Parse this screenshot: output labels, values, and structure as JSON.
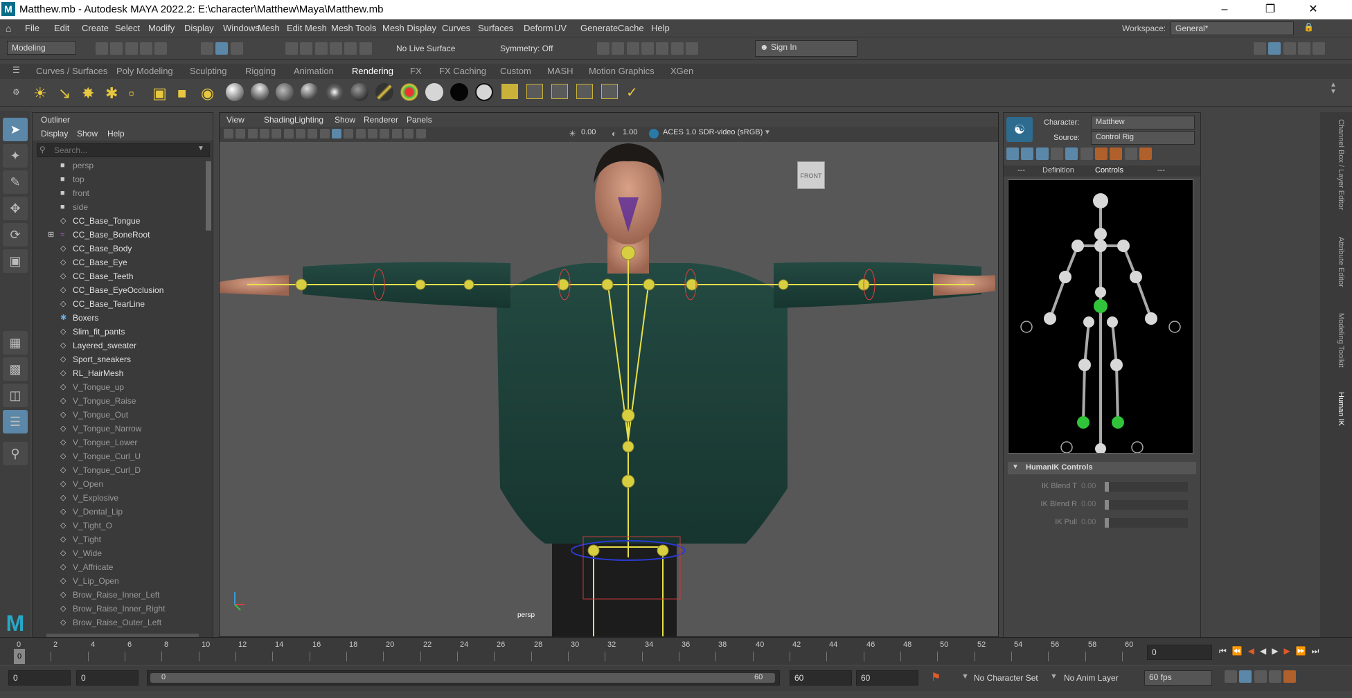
{
  "window": {
    "title": "Matthew.mb - Autodesk MAYA 2022.2: E:\\character\\Matthew\\Maya\\Matthew.mb",
    "logo": "M"
  },
  "menu": [
    "File",
    "Edit",
    "Create",
    "Select",
    "Modify",
    "Display",
    "Windows",
    "Mesh",
    "Edit Mesh",
    "Mesh Tools",
    "Mesh Display",
    "Curves",
    "Surfaces",
    "Deform",
    "UV",
    "Generate",
    "Cache",
    "Help"
  ],
  "workspace": {
    "label": "Workspace:",
    "value": "General*"
  },
  "status": {
    "mode": "Modeling",
    "live_surface": "No Live Surface",
    "symmetry": "Symmetry: Off",
    "sign_in": "Sign In"
  },
  "shelf_tabs": [
    "Curves / Surfaces",
    "Poly Modeling",
    "Sculpting",
    "Rigging",
    "Animation",
    "Rendering",
    "FX",
    "FX Caching",
    "Custom",
    "MASH",
    "Motion Graphics",
    "XGen"
  ],
  "shelf_active": "Rendering",
  "outliner": {
    "title": "Outliner",
    "menu": [
      "Display",
      "Show",
      "Help"
    ],
    "search_placeholder": "Search...",
    "items": [
      {
        "label": "persp",
        "icon": "camera-icon",
        "dim": true
      },
      {
        "label": "top",
        "icon": "camera-icon",
        "dim": true
      },
      {
        "label": "front",
        "icon": "camera-icon",
        "dim": true
      },
      {
        "label": "side",
        "icon": "camera-icon",
        "dim": true
      },
      {
        "label": "CC_Base_Tongue",
        "icon": "mesh-icon",
        "dim": false
      },
      {
        "label": "CC_Base_BoneRoot",
        "icon": "joint-icon",
        "dim": false
      },
      {
        "label": "CC_Base_Body",
        "icon": "mesh-icon",
        "dim": false
      },
      {
        "label": "CC_Base_Eye",
        "icon": "mesh-icon",
        "dim": false
      },
      {
        "label": "CC_Base_Teeth",
        "icon": "mesh-icon",
        "dim": false
      },
      {
        "label": "CC_Base_EyeOcclusion",
        "icon": "mesh-icon",
        "dim": false
      },
      {
        "label": "CC_Base_TearLine",
        "icon": "mesh-icon",
        "dim": false
      },
      {
        "label": "Boxers",
        "icon": "nucleus-icon",
        "dim": false
      },
      {
        "label": "Slim_fit_pants",
        "icon": "mesh-icon",
        "dim": false
      },
      {
        "label": "Layered_sweater",
        "icon": "mesh-icon",
        "dim": false
      },
      {
        "label": "Sport_sneakers",
        "icon": "mesh-icon",
        "dim": false
      },
      {
        "label": "RL_HairMesh",
        "icon": "mesh-icon",
        "dim": false
      },
      {
        "label": "V_Tongue_up",
        "icon": "mesh-icon",
        "dim": true
      },
      {
        "label": "V_Tongue_Raise",
        "icon": "mesh-icon",
        "dim": true
      },
      {
        "label": "V_Tongue_Out",
        "icon": "mesh-icon",
        "dim": true
      },
      {
        "label": "V_Tongue_Narrow",
        "icon": "mesh-icon",
        "dim": true
      },
      {
        "label": "V_Tongue_Lower",
        "icon": "mesh-icon",
        "dim": true
      },
      {
        "label": "V_Tongue_Curl_U",
        "icon": "mesh-icon",
        "dim": true
      },
      {
        "label": "V_Tongue_Curl_D",
        "icon": "mesh-icon",
        "dim": true
      },
      {
        "label": "V_Open",
        "icon": "mesh-icon",
        "dim": true
      },
      {
        "label": "V_Explosive",
        "icon": "mesh-icon",
        "dim": true
      },
      {
        "label": "V_Dental_Lip",
        "icon": "mesh-icon",
        "dim": true
      },
      {
        "label": "V_Tight_O",
        "icon": "mesh-icon",
        "dim": true
      },
      {
        "label": "V_Tight",
        "icon": "mesh-icon",
        "dim": true
      },
      {
        "label": "V_Wide",
        "icon": "mesh-icon",
        "dim": true
      },
      {
        "label": "V_Affricate",
        "icon": "mesh-icon",
        "dim": true
      },
      {
        "label": "V_Lip_Open",
        "icon": "mesh-icon",
        "dim": true
      },
      {
        "label": "Brow_Raise_Inner_Left",
        "icon": "mesh-icon",
        "dim": true
      },
      {
        "label": "Brow_Raise_Inner_Right",
        "icon": "mesh-icon",
        "dim": true
      },
      {
        "label": "Brow_Raise_Outer_Left",
        "icon": "mesh-icon",
        "dim": true
      }
    ]
  },
  "viewport": {
    "menu": [
      "View",
      "Shading",
      "Lighting",
      "Show",
      "Renderer",
      "Panels"
    ],
    "near": "0.00",
    "far": "1.00",
    "colorspace": "ACES 1.0 SDR-video (sRGB)",
    "viewcube": "FRONT",
    "camera": "persp"
  },
  "hik": {
    "character_label": "Character:",
    "character": "Matthew",
    "source_label": "Source:",
    "source": "Control Rig",
    "tabs": [
      "---",
      "Definition",
      "Controls",
      "---"
    ],
    "active_tab": "Controls",
    "section": "HumanIK Controls",
    "controls": [
      {
        "label": "IK Blend T",
        "value": "0.00"
      },
      {
        "label": "IK Blend R",
        "value": "0.00"
      },
      {
        "label": "IK Pull",
        "value": "0.00"
      }
    ]
  },
  "right_tabs": [
    "Channel Box / Layer Editor",
    "Attribute Editor",
    "Modeling Toolkit",
    "Human IK"
  ],
  "timeline": {
    "ticks": [
      "0",
      "2",
      "4",
      "6",
      "8",
      "10",
      "12",
      "14",
      "16",
      "18",
      "20",
      "22",
      "24",
      "26",
      "28",
      "30",
      "32",
      "34",
      "36",
      "38",
      "40",
      "42",
      "44",
      "46",
      "48",
      "50",
      "52",
      "54",
      "56",
      "58",
      "60"
    ],
    "current": "0",
    "current_field": "0"
  },
  "range": {
    "start": "0",
    "anim_start": "0",
    "range_start": "0",
    "range_end": "60",
    "anim_end": "60",
    "end": "60",
    "character_set": "No Character Set",
    "anim_layer": "No Anim Layer",
    "fps": "60 fps"
  }
}
